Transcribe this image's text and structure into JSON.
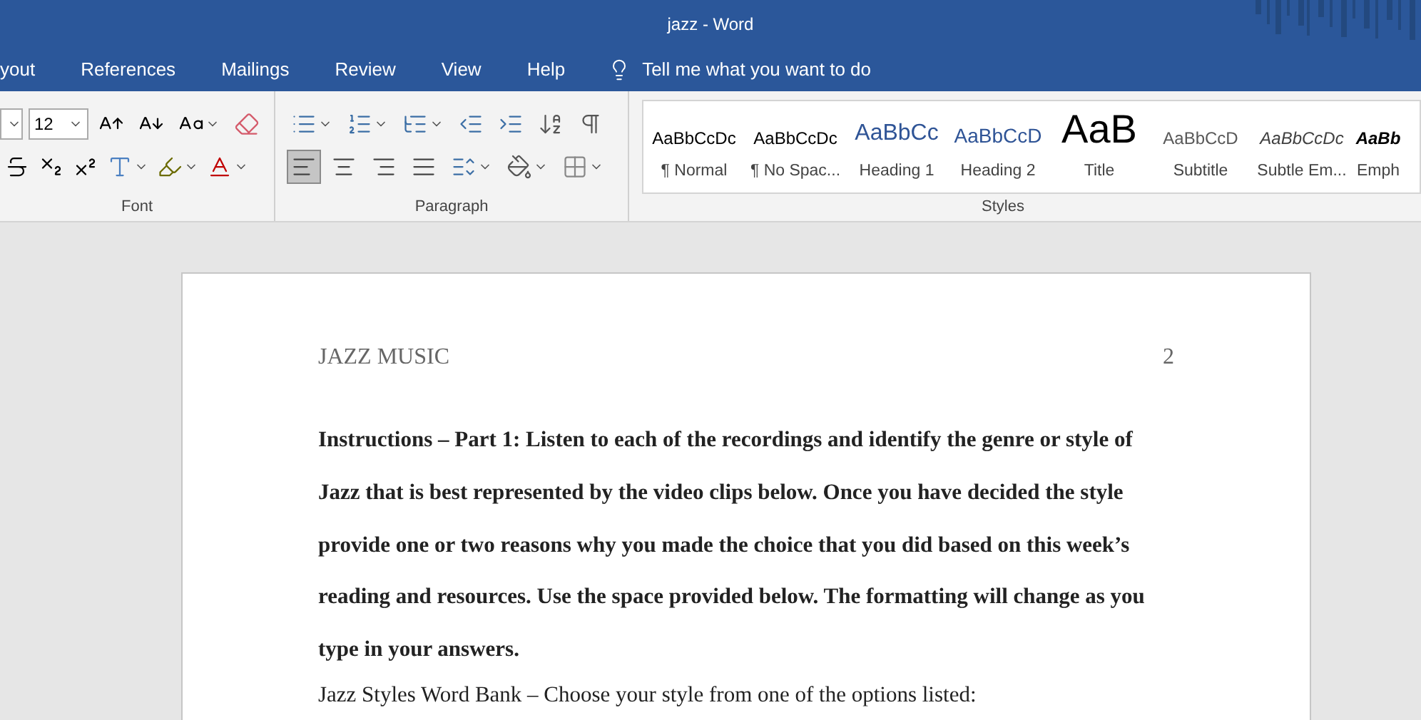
{
  "window": {
    "title": "jazz  -  Word"
  },
  "tabs": [
    {
      "label": "yout",
      "selected": false
    },
    {
      "label": "References",
      "selected": false
    },
    {
      "label": "Mailings",
      "selected": false
    },
    {
      "label": "Review",
      "selected": false
    },
    {
      "label": "View",
      "selected": false
    },
    {
      "label": "Help",
      "selected": false
    }
  ],
  "tell_me": {
    "placeholder": "Tell me what you want to do"
  },
  "font_group": {
    "label": "Font",
    "font_size": "12"
  },
  "paragraph_group": {
    "label": "Paragraph",
    "alignments": [
      {
        "kind": "left",
        "selected": true
      },
      {
        "kind": "center",
        "selected": false
      },
      {
        "kind": "right",
        "selected": false
      },
      {
        "kind": "justify",
        "selected": false
      }
    ]
  },
  "styles_group": {
    "label": "Styles",
    "items": [
      {
        "sample": "AaBbCcDc",
        "label": "¶ Normal",
        "kind": "normal"
      },
      {
        "sample": "AaBbCcDc",
        "label": "¶ No Spac...",
        "kind": "normal"
      },
      {
        "sample": "AaBbCc",
        "label": "Heading 1",
        "kind": "heading1"
      },
      {
        "sample": "AaBbCcD",
        "label": "Heading 2",
        "kind": "heading2"
      },
      {
        "sample": "AaB",
        "label": "Title",
        "kind": "title"
      },
      {
        "sample": "AaBbCcD",
        "label": "Subtitle",
        "kind": "subtitle"
      },
      {
        "sample": "AaBbCcDc",
        "label": "Subtle Em...",
        "kind": "emphasis"
      },
      {
        "sample": "AaBb",
        "label": "Emph",
        "kind": "emphasis_strong"
      }
    ]
  },
  "document": {
    "header": "JAZZ MUSIC",
    "page_number": "2",
    "paragraphs": [
      {
        "text": "Instructions – Part 1: Listen to each of the recordings and identify the genre or style of Jazz that is best represented by the video clips below. Once you have decided the style provide one or two reasons why you made the choice that you did based on this week’s reading and resources. Use the space provided below. The formatting will change as you type in your answers.",
        "bold": true
      },
      {
        "text": "Jazz Styles Word Bank – Choose your style from one of the options listed:",
        "bold": false
      }
    ]
  }
}
